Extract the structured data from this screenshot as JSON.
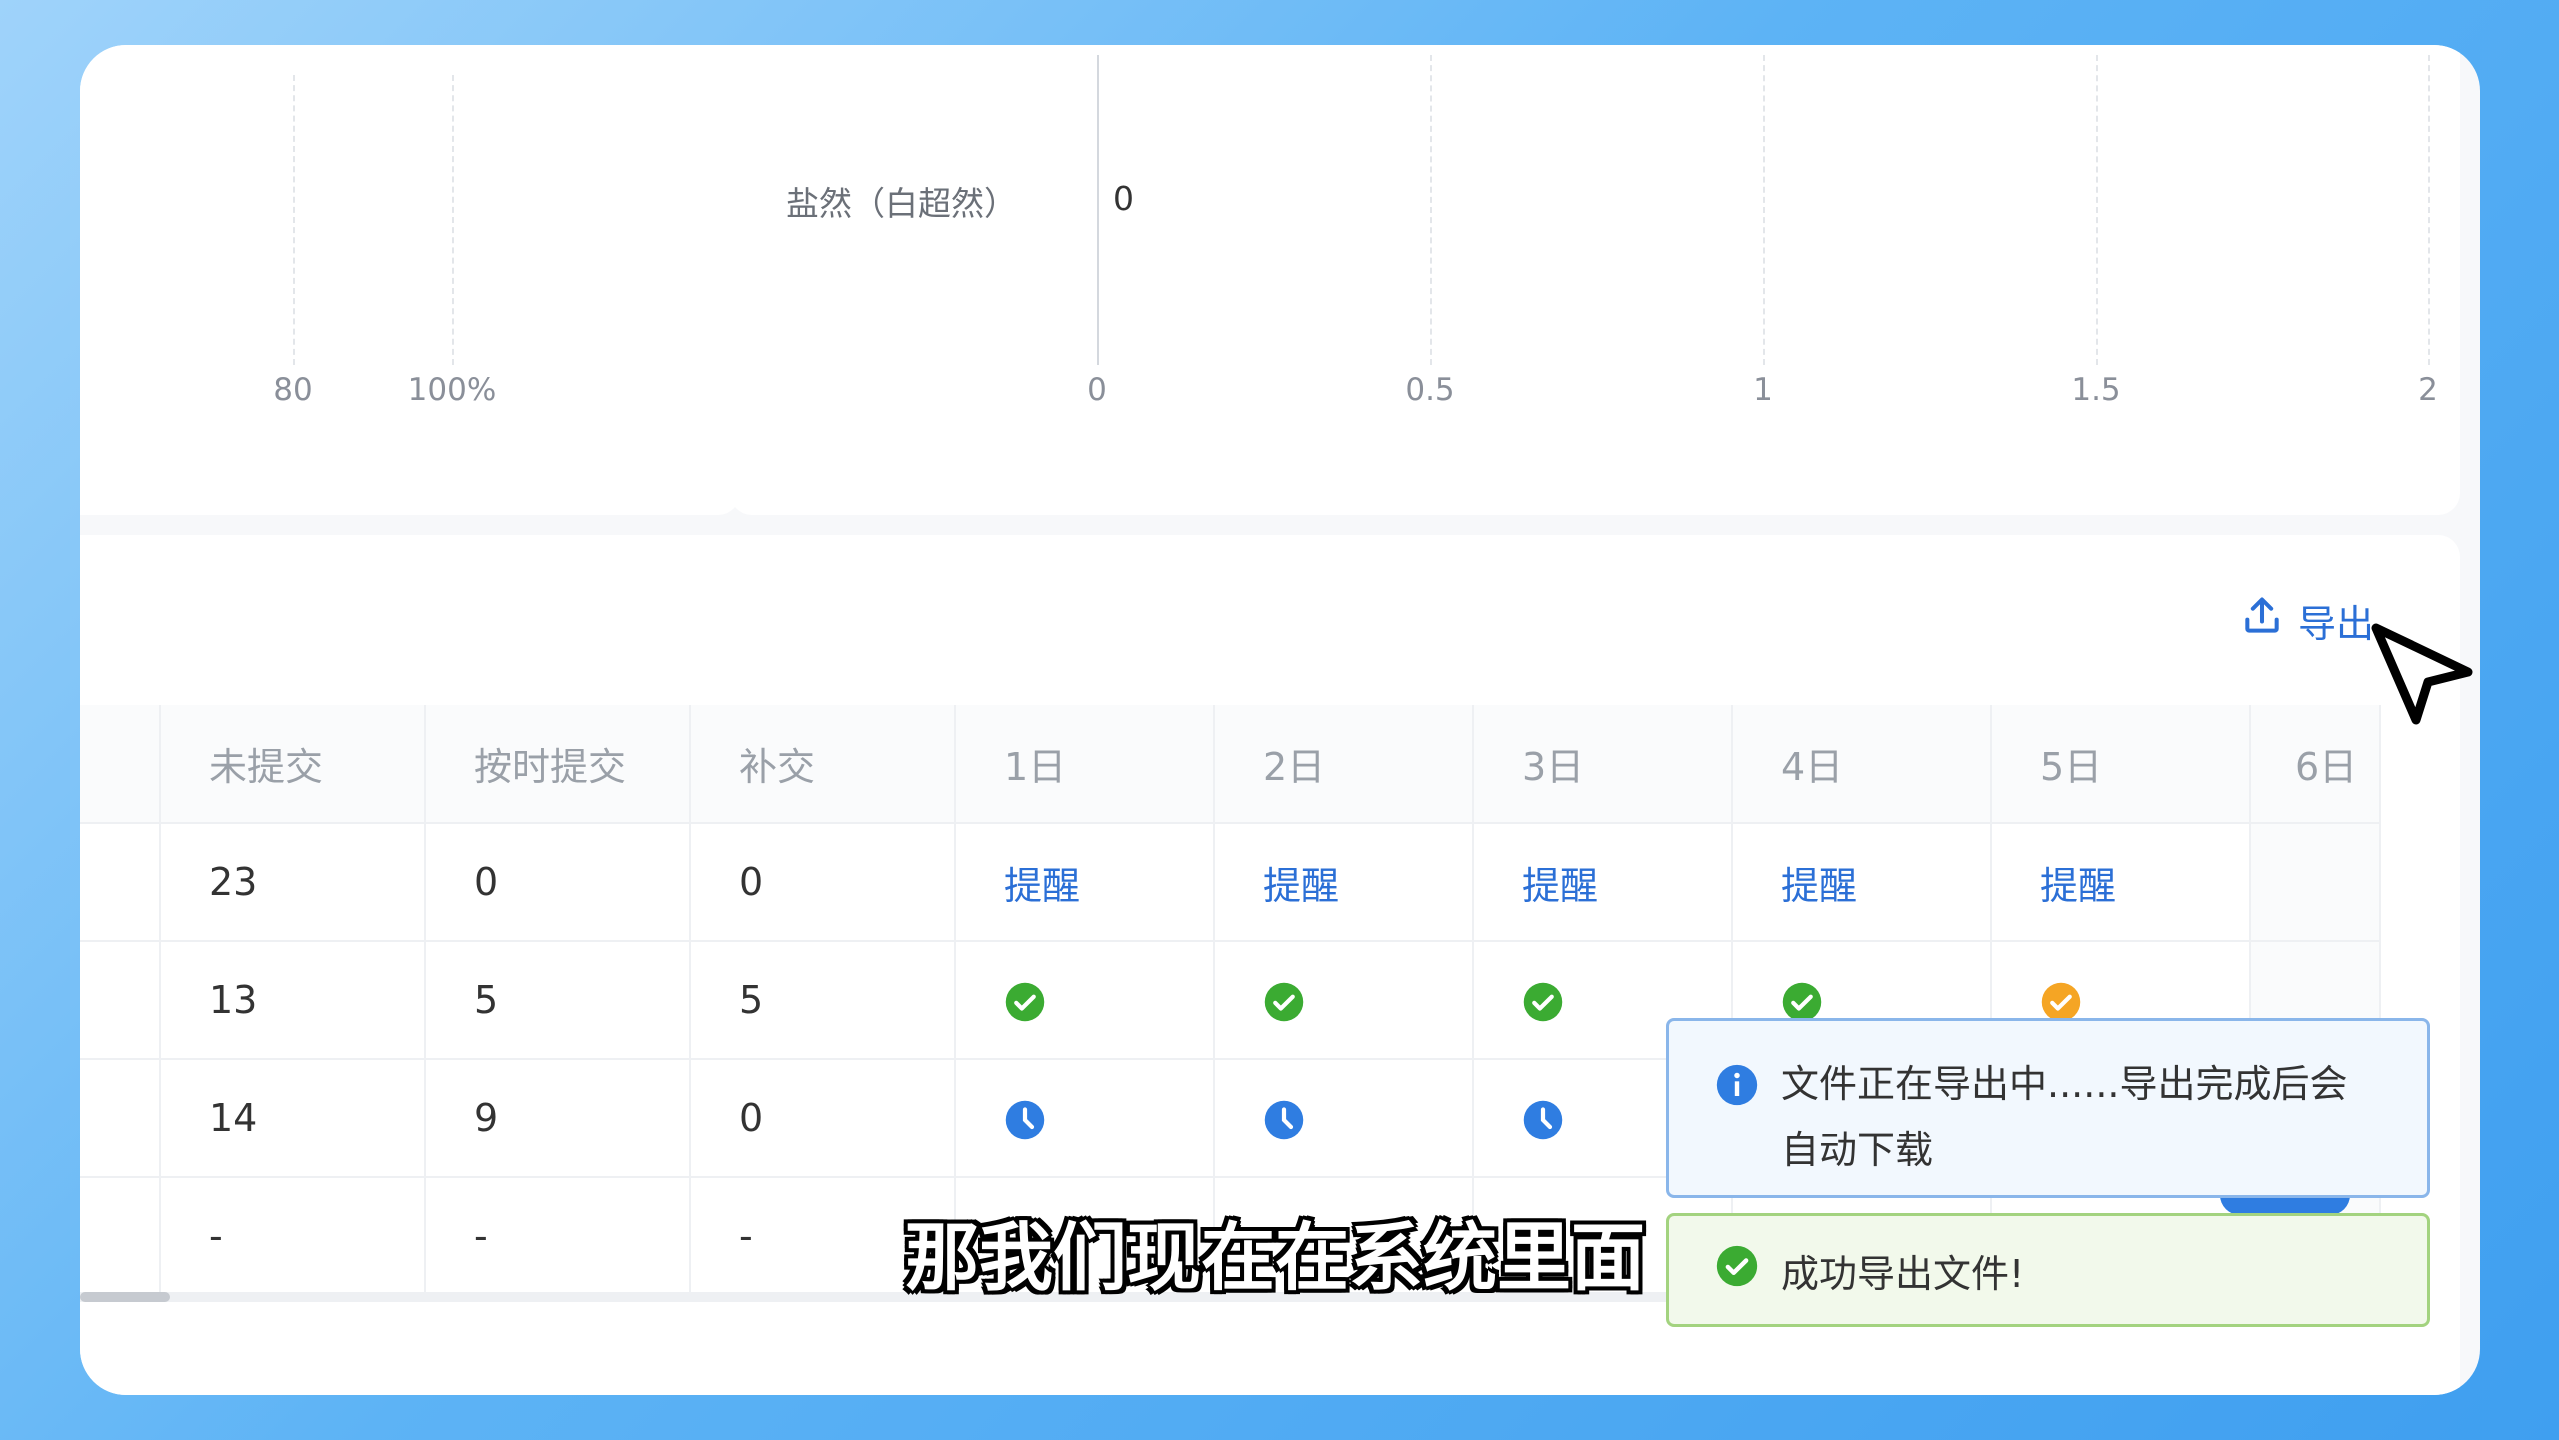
{
  "left_chart": {
    "ticks": [
      "80",
      "100%"
    ]
  },
  "right_chart": {
    "bar_label": "盐然（白超然）",
    "bar_value": "0",
    "ticks": [
      "0",
      "0.5",
      "1",
      "1.5",
      "2"
    ]
  },
  "toolbar": {
    "export_label": "导出"
  },
  "table": {
    "headers": [
      "未提交",
      "按时提交",
      "补交",
      "1日",
      "2日",
      "3日",
      "4日",
      "5日",
      "6日"
    ],
    "rows": [
      {
        "c0": "23",
        "c1": "0",
        "c2": "0",
        "days": [
          "提醒",
          "提醒",
          "提醒",
          "提醒",
          "提醒"
        ]
      },
      {
        "c0": "13",
        "c1": "5",
        "c2": "5",
        "days": [
          "done-green-icon",
          "done-green-icon",
          "done-green-icon",
          "done-green-icon",
          "done-orange-icon"
        ]
      },
      {
        "c0": "14",
        "c1": "9",
        "c2": "0",
        "days": [
          "clock-icon",
          "clock-icon",
          "clock-icon"
        ]
      },
      {
        "c0": "-",
        "c1": "-",
        "c2": "-"
      }
    ]
  },
  "notifications": {
    "info": "文件正在导出中......导出完成后会自动下载",
    "success": "成功导出文件!"
  },
  "subtitle": "那我们现在在系统里面",
  "colors": {
    "accent_blue": "#2b6fd6",
    "success_green": "#3bab32",
    "warning_orange": "#f5a524",
    "clock_blue": "#2f7de1"
  }
}
